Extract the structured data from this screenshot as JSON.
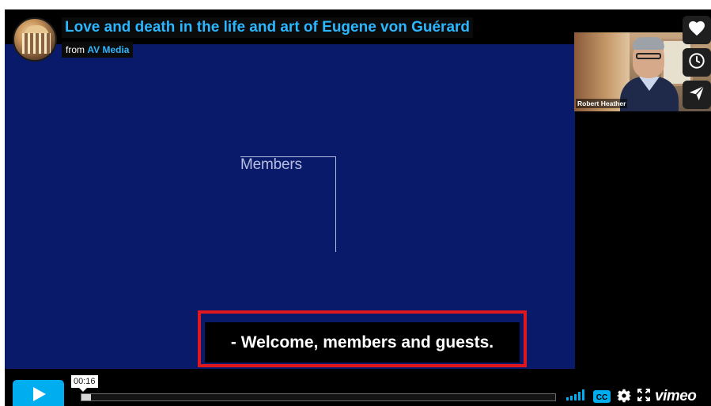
{
  "video": {
    "title": "Love and death in the life and art of Eugene von Guérard",
    "byline_prefix": "from",
    "author": "AV Media",
    "author_color": "#2bb7ff"
  },
  "slide": {
    "label": "Members",
    "background_color": "#0a1a6b"
  },
  "webcam": {
    "speaker_name": "Robert Heather"
  },
  "side_actions": [
    {
      "name": "like",
      "icon": "heart-icon"
    },
    {
      "name": "watch-later",
      "icon": "clock-icon"
    },
    {
      "name": "share",
      "icon": "paper-plane-icon"
    }
  ],
  "caption": {
    "text": "- Welcome, members and guests.",
    "highlight_color": "#e0181e"
  },
  "controls": {
    "play_icon": "play-icon",
    "timecode": "00:16",
    "progress_fraction": 0.02,
    "loaded_fraction": 0.02,
    "accent_color": "#00adef",
    "volume_icon": "volume-bars-icon",
    "cc_label": "CC",
    "settings_icon": "gear-icon",
    "fullscreen_icon": "fullscreen-icon",
    "brand": "vimeo"
  }
}
